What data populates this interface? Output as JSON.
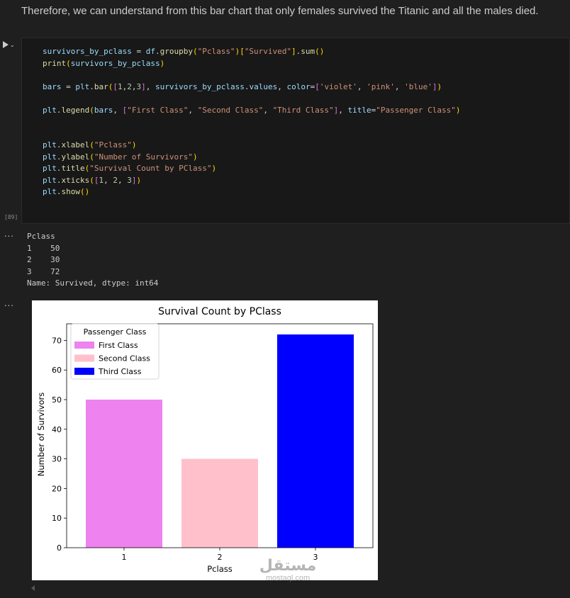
{
  "markdown": {
    "text": "Therefore, we can understand from this bar chart that only females survived the Titanic and all the males died."
  },
  "cell": {
    "execution_count": "[89]",
    "code_lines": [
      "survivors_by_pclass = df.groupby(\"Pclass\")[\"Survived\"].sum()",
      "print(survivors_by_pclass)",
      "",
      "bars = plt.bar([1,2,3], survivors_by_pclass.values, color=['violet', 'pink', 'blue'])",
      "",
      "plt.legend(bars, [\"First Class\", \"Second Class\", \"Third Class\"], title=\"Passenger Class\")",
      "",
      "",
      "plt.xlabel(\"Pclass\")",
      "plt.ylabel(\"Number of Survivors\")",
      "plt.title(\"Survival Count by PClass\")",
      "plt.xticks([1, 2, 3])",
      "plt.show()"
    ]
  },
  "output": {
    "ellipsis": "...",
    "text_lines": [
      "Pclass",
      "1    50",
      "2    30",
      "3    72",
      "Name: Survived, dtype: int64"
    ]
  },
  "chart_data": {
    "type": "bar",
    "title": "Survival Count by PClass",
    "xlabel": "Pclass",
    "ylabel": "Number of Survivors",
    "categories": [
      "1",
      "2",
      "3"
    ],
    "values": [
      50,
      30,
      72
    ],
    "colors": [
      "#ee82ee",
      "#ffc0cb",
      "#0000ff"
    ],
    "ylim": [
      0,
      75.6
    ],
    "yticks": [
      0,
      10,
      20,
      30,
      40,
      50,
      60,
      70
    ],
    "legend": {
      "title": "Passenger Class",
      "placement": "top-left",
      "entries": [
        "First Class",
        "Second Class",
        "Third Class"
      ]
    },
    "grid": false
  },
  "watermark": {
    "arabic": "مستقل",
    "latin": "mostaql.com"
  }
}
